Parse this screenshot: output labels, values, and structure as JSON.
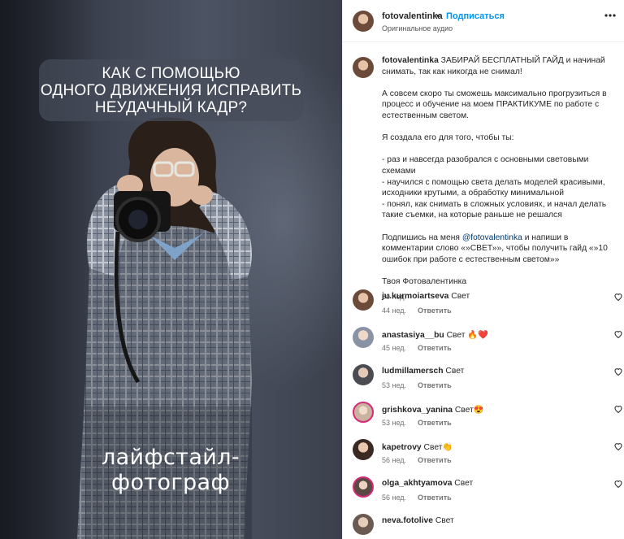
{
  "media": {
    "overlay_lines": [
      "КАК С ПОМОЩЬЮ",
      "ОДНОГО ДВИЖЕНИЯ ИСПРАВИТЬ",
      "НЕУДАЧНЫЙ КАДР?"
    ],
    "overlay_subtitle": "лайфстайл-фотограф"
  },
  "header": {
    "username": "fotovalentinka",
    "dot": "•",
    "follow_label": "Подписаться",
    "audio_label": "Оригинальное аудио",
    "more_icon": "more-horizontal-icon"
  },
  "caption": {
    "username": "fotovalentinka",
    "first": " ЗАБИРАЙ БЕСПЛАТНЫЙ ГАЙД и начинай снимать, так как никогда не снимал!",
    "p2": "А совсем скоро ты сможешь максимально прогрузиться в процесс и обучение на моем ПРАКТИКУМЕ по работе с естественным светом.",
    "p3": "Я создала его для того, чтобы ты:",
    "bullets": [
      "- раз и навсегда разобрался с основными световыми схемами",
      "- научился с помощью света делать моделей красивыми, исходники крутыми, а обработку минимальной",
      "- понял, как снимать в сложных условиях, и начал делать такие съемки, на которые раньше не решался"
    ],
    "p5_before": "Подпишись на меня ",
    "p5_mention": "@fotovalentinka",
    "p5_after": " и напиши в комментарии слово «»СВЕТ»», чтобы получить гайд «»10 ошибок при работе с естественным светом»»",
    "signature": "Твоя Фотовалентинка",
    "time": "60 нед."
  },
  "comments": [
    {
      "user": "ju.kurmoiartseva",
      "text": "Свет",
      "time": "44 нед.",
      "reply": "Ответить"
    },
    {
      "user": "anastasiya__bu",
      "text": "Свет 🔥❤️",
      "time": "45 нед.",
      "reply": "Ответить"
    },
    {
      "user": "ludmillamersch",
      "text": "Свет",
      "time": "53 нед.",
      "reply": "Ответить"
    },
    {
      "user": "grishkova_yanina",
      "text": "Свет😍",
      "time": "53 нед.",
      "reply": "Ответить"
    },
    {
      "user": "kapetrovy",
      "text": "Свет👏",
      "time": "56 нед.",
      "reply": "Ответить"
    },
    {
      "user": "olga_akhtyamova",
      "text": "Свет",
      "time": "56 нед.",
      "reply": "Ответить"
    },
    {
      "user": "neva.fotolive",
      "text": "Свет",
      "time": "",
      "reply": ""
    }
  ],
  "icons": {
    "like": "heart-outline-icon"
  },
  "colors": {
    "link": "#0095f6",
    "mention": "#00376b",
    "muted": "#737373"
  }
}
